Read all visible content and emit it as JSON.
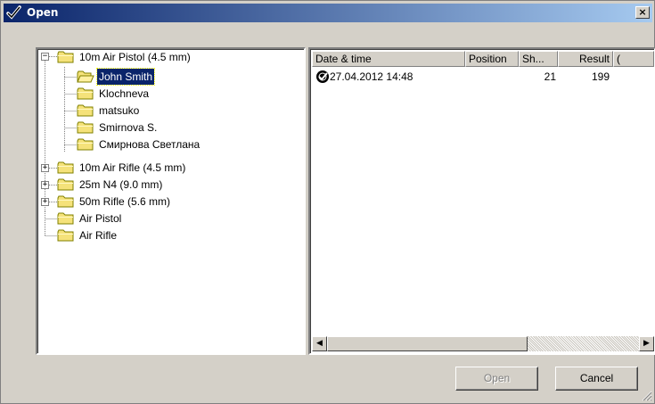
{
  "dialog": {
    "title": "Open",
    "close_glyph": "×"
  },
  "tree": {
    "items": [
      {
        "label": "10m Air Pistol (4.5 mm)",
        "expander": "−"
      },
      {
        "label": "John Smith"
      },
      {
        "label": "Klochneva"
      },
      {
        "label": "matsuko"
      },
      {
        "label": "Smirnova S."
      },
      {
        "label": "Смирнова Светлана"
      },
      {
        "label": "10m Air Rifle (4.5 mm)",
        "expander": "+"
      },
      {
        "label": "25m N4 (9.0 mm)",
        "expander": "+"
      },
      {
        "label": "50m Rifle (5.6 mm)",
        "expander": "+"
      },
      {
        "label": "Air Pistol"
      },
      {
        "label": "Air Rifle"
      }
    ],
    "selected_index": 1
  },
  "list": {
    "columns": [
      "Date & time",
      "Position",
      "Sh...",
      "Result",
      "("
    ],
    "rows": [
      {
        "date": "27.04.2012 14:48",
        "position": "",
        "shots": "21",
        "result": "199",
        "icon": "target-check-icon"
      }
    ]
  },
  "buttons": {
    "open_label": "Open",
    "cancel_label": "Cancel"
  },
  "colors": {
    "title_gradient_start": "#0a246a",
    "title_gradient_end": "#a6caf0",
    "selection": "#0a246a",
    "folder_yellow": "#f5e27a"
  }
}
